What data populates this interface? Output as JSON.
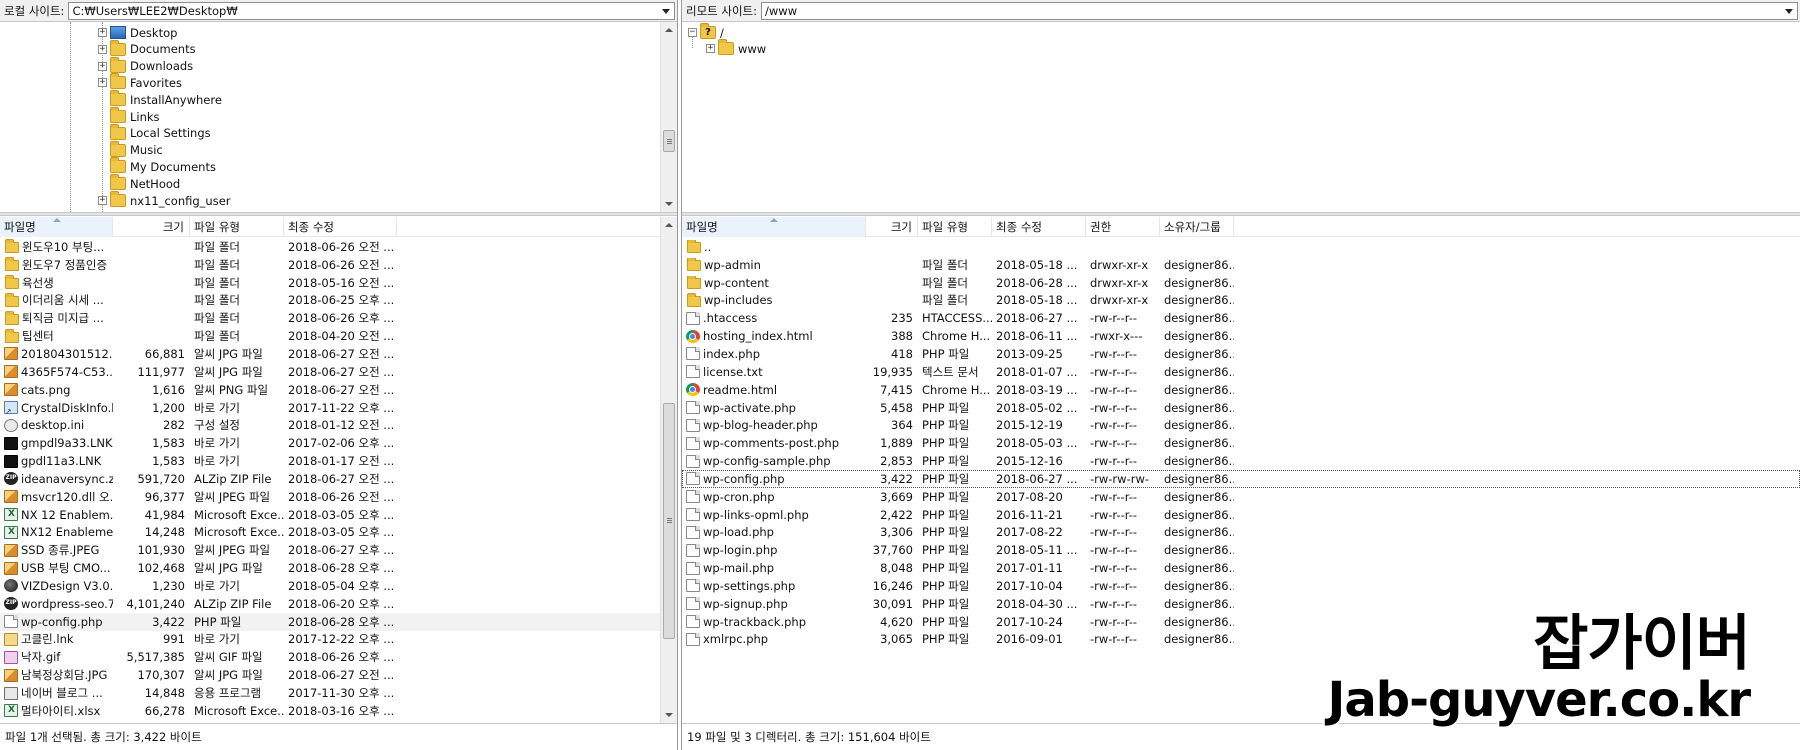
{
  "left": {
    "site_label": "로컬 사이트:",
    "site_path": "C:₩Users₩LEE2₩Desktop₩",
    "tree": [
      {
        "label": "Desktop",
        "icon": "desktop-folder-icon",
        "expander": "+"
      },
      {
        "label": "Documents",
        "icon": "folder-icon",
        "expander": "+"
      },
      {
        "label": "Downloads",
        "icon": "folder-icon",
        "expander": "+"
      },
      {
        "label": "Favorites",
        "icon": "favorites-folder-icon",
        "expander": "+"
      },
      {
        "label": "InstallAnywhere",
        "icon": "folder-icon",
        "expander": ""
      },
      {
        "label": "Links",
        "icon": "links-folder-icon",
        "expander": ""
      },
      {
        "label": "Local Settings",
        "icon": "folder-icon",
        "expander": ""
      },
      {
        "label": "Music",
        "icon": "folder-icon",
        "expander": ""
      },
      {
        "label": "My Documents",
        "icon": "folder-icon",
        "expander": ""
      },
      {
        "label": "NetHood",
        "icon": "folder-icon",
        "expander": ""
      },
      {
        "label": "nx11_config_user",
        "icon": "folder-icon",
        "expander": "+"
      }
    ],
    "columns": [
      "파일명",
      "크기",
      "파일 유형",
      "최종 수정"
    ],
    "files": [
      {
        "name": "윈도우10 부팅...",
        "size": "",
        "type": "파일 폴더",
        "modified": "2018-06-26 오전 ...",
        "icon": "folder"
      },
      {
        "name": "윈도우7 정품인증",
        "size": "",
        "type": "파일 폴더",
        "modified": "2018-06-26 오전 ...",
        "icon": "folder"
      },
      {
        "name": "육선생",
        "size": "",
        "type": "파일 폴더",
        "modified": "2018-05-16 오전 ...",
        "icon": "folder"
      },
      {
        "name": "이더리움 시세 ...",
        "size": "",
        "type": "파일 폴더",
        "modified": "2018-06-25 오후 ...",
        "icon": "folder"
      },
      {
        "name": "퇴직금 미지급 ...",
        "size": "",
        "type": "파일 폴더",
        "modified": "2018-06-26 오후 ...",
        "icon": "folder"
      },
      {
        "name": "팁센터",
        "size": "",
        "type": "파일 폴더",
        "modified": "2018-04-20 오전 ...",
        "icon": "folder"
      },
      {
        "name": "201804301512...",
        "size": "66,881",
        "type": "알씨 JPG 파일",
        "modified": "2018-06-27 오전 ...",
        "icon": "image"
      },
      {
        "name": "4365F574-C53...",
        "size": "111,977",
        "type": "알씨 JPG 파일",
        "modified": "2018-06-27 오전 ...",
        "icon": "image"
      },
      {
        "name": "cats.png",
        "size": "1,616",
        "type": "알씨 PNG 파일",
        "modified": "2018-06-27 오전 ...",
        "icon": "image"
      },
      {
        "name": "CrystalDiskInfo.l...",
        "size": "1,200",
        "type": "바로 가기",
        "modified": "2017-11-22 오후 ...",
        "icon": "shortcut"
      },
      {
        "name": "desktop.ini",
        "size": "282",
        "type": "구성 설정",
        "modified": "2018-01-12 오전 ...",
        "icon": "settings"
      },
      {
        "name": "gmpdl9a33.LNK",
        "size": "1,583",
        "type": "바로 가기",
        "modified": "2017-02-06 오후 ...",
        "icon": "blackapp"
      },
      {
        "name": "gpdl11a3.LNK",
        "size": "1,583",
        "type": "바로 가기",
        "modified": "2018-01-17 오전 ...",
        "icon": "blackapp"
      },
      {
        "name": "ideanaversync.zip",
        "size": "591,720",
        "type": "ALZip ZIP File",
        "modified": "2018-06-27 오전 ...",
        "icon": "zip"
      },
      {
        "name": "msvcr120.dll 오...",
        "size": "96,377",
        "type": "알씨 JPEG 파일",
        "modified": "2018-06-26 오전 ...",
        "icon": "image"
      },
      {
        "name": "NX 12 Enablem...",
        "size": "41,984",
        "type": "Microsoft Exce...",
        "modified": "2018-03-05 오후 ...",
        "icon": "excel"
      },
      {
        "name": "NX12 Enableme...",
        "size": "14,248",
        "type": "Microsoft Exce...",
        "modified": "2018-03-05 오후 ...",
        "icon": "excel"
      },
      {
        "name": "SSD 종류.JPEG",
        "size": "101,930",
        "type": "알씨 JPEG 파일",
        "modified": "2018-06-27 오후 ...",
        "icon": "image"
      },
      {
        "name": "USB 부팅 CMO...",
        "size": "102,468",
        "type": "알씨 JPG 파일",
        "modified": "2018-06-28 오후 ...",
        "icon": "image"
      },
      {
        "name": "VIZDesign V3.0....",
        "size": "1,230",
        "type": "바로 가기",
        "modified": "2018-05-04 오후 ...",
        "icon": "viz"
      },
      {
        "name": "wordpress-seo.7....",
        "size": "4,101,240",
        "type": "ALZip ZIP File",
        "modified": "2018-06-20 오후 ...",
        "icon": "zip"
      },
      {
        "name": "wp-config.php",
        "size": "3,422",
        "type": "PHP 파일",
        "modified": "2018-06-28 오후 ...",
        "icon": "doc",
        "selected": true
      },
      {
        "name": "고클린.lnk",
        "size": "991",
        "type": "바로 가기",
        "modified": "2017-12-22 오후 ...",
        "icon": "hangul"
      },
      {
        "name": "낙자.gif",
        "size": "5,517,385",
        "type": "알씨 GIF 파일",
        "modified": "2018-06-26 오후 ...",
        "icon": "gif"
      },
      {
        "name": "남북정상회담.JPG",
        "size": "170,307",
        "type": "알씨 JPG 파일",
        "modified": "2018-06-27 오전 ...",
        "icon": "image"
      },
      {
        "name": "네이버 블로그 ...",
        "size": "14,848",
        "type": "응용 프로그램",
        "modified": "2017-11-30 오후 ...",
        "icon": "app"
      },
      {
        "name": "멀타아이티.xlsx",
        "size": "66,278",
        "type": "Microsoft Exce...",
        "modified": "2018-03-16 오후 ...",
        "icon": "excel"
      }
    ],
    "status": "파일 1개 선택됨. 총 크기: 3,422 바이트"
  },
  "right": {
    "site_label": "리모트 사이트:",
    "site_path": "/www",
    "tree": [
      {
        "label": "/",
        "icon": "unknown-folder-icon",
        "expander": "−"
      },
      {
        "label": "www",
        "icon": "folder-icon",
        "expander": "+"
      }
    ],
    "columns": [
      "파일명",
      "크기",
      "파일 유형",
      "최종 수정",
      "권한",
      "소유자/그룹"
    ],
    "files": [
      {
        "name": "..",
        "size": "",
        "type": "",
        "modified": "",
        "perm": "",
        "owner": "",
        "icon": "folder"
      },
      {
        "name": "wp-admin",
        "size": "",
        "type": "파일 폴더",
        "modified": "2018-05-18 ...",
        "perm": "drwxr-xr-x",
        "owner": "designer86...",
        "icon": "folder"
      },
      {
        "name": "wp-content",
        "size": "",
        "type": "파일 폴더",
        "modified": "2018-06-28 ...",
        "perm": "drwxr-xr-x",
        "owner": "designer86...",
        "icon": "folder"
      },
      {
        "name": "wp-includes",
        "size": "",
        "type": "파일 폴더",
        "modified": "2018-05-18 ...",
        "perm": "drwxr-xr-x",
        "owner": "designer86...",
        "icon": "folder"
      },
      {
        "name": ".htaccess",
        "size": "235",
        "type": "HTACCESS...",
        "modified": "2018-06-27 ...",
        "perm": "-rw-r--r--",
        "owner": "designer86...",
        "icon": "doc"
      },
      {
        "name": "hosting_index.html",
        "size": "388",
        "type": "Chrome H...",
        "modified": "2018-06-11 ...",
        "perm": "-rwxr-x---",
        "owner": "designer86...",
        "icon": "chrome"
      },
      {
        "name": "index.php",
        "size": "418",
        "type": "PHP 파일",
        "modified": "2013-09-25",
        "perm": "-rw-r--r--",
        "owner": "designer86...",
        "icon": "doc"
      },
      {
        "name": "license.txt",
        "size": "19,935",
        "type": "텍스트 문서",
        "modified": "2018-01-07 ...",
        "perm": "-rw-r--r--",
        "owner": "designer86...",
        "icon": "doc"
      },
      {
        "name": "readme.html",
        "size": "7,415",
        "type": "Chrome H...",
        "modified": "2018-03-19 ...",
        "perm": "-rw-r--r--",
        "owner": "designer86...",
        "icon": "chrome"
      },
      {
        "name": "wp-activate.php",
        "size": "5,458",
        "type": "PHP 파일",
        "modified": "2018-05-02 ...",
        "perm": "-rw-r--r--",
        "owner": "designer86...",
        "icon": "doc"
      },
      {
        "name": "wp-blog-header.php",
        "size": "364",
        "type": "PHP 파일",
        "modified": "2015-12-19",
        "perm": "-rw-r--r--",
        "owner": "designer86...",
        "icon": "doc"
      },
      {
        "name": "wp-comments-post.php",
        "size": "1,889",
        "type": "PHP 파일",
        "modified": "2018-05-03 ...",
        "perm": "-rw-r--r--",
        "owner": "designer86...",
        "icon": "doc"
      },
      {
        "name": "wp-config-sample.php",
        "size": "2,853",
        "type": "PHP 파일",
        "modified": "2015-12-16",
        "perm": "-rw-r--r--",
        "owner": "designer86...",
        "icon": "doc"
      },
      {
        "name": "wp-config.php",
        "size": "3,422",
        "type": "PHP 파일",
        "modified": "2018-06-27 ...",
        "perm": "-rw-rw-rw-",
        "owner": "designer86...",
        "icon": "doc",
        "focused": true
      },
      {
        "name": "wp-cron.php",
        "size": "3,669",
        "type": "PHP 파일",
        "modified": "2017-08-20",
        "perm": "-rw-r--r--",
        "owner": "designer86...",
        "icon": "doc"
      },
      {
        "name": "wp-links-opml.php",
        "size": "2,422",
        "type": "PHP 파일",
        "modified": "2016-11-21",
        "perm": "-rw-r--r--",
        "owner": "designer86...",
        "icon": "doc"
      },
      {
        "name": "wp-load.php",
        "size": "3,306",
        "type": "PHP 파일",
        "modified": "2017-08-22",
        "perm": "-rw-r--r--",
        "owner": "designer86...",
        "icon": "doc"
      },
      {
        "name": "wp-login.php",
        "size": "37,760",
        "type": "PHP 파일",
        "modified": "2018-05-11 ...",
        "perm": "-rw-r--r--",
        "owner": "designer86...",
        "icon": "doc"
      },
      {
        "name": "wp-mail.php",
        "size": "8,048",
        "type": "PHP 파일",
        "modified": "2017-01-11",
        "perm": "-rw-r--r--",
        "owner": "designer86...",
        "icon": "doc"
      },
      {
        "name": "wp-settings.php",
        "size": "16,246",
        "type": "PHP 파일",
        "modified": "2017-10-04",
        "perm": "-rw-r--r--",
        "owner": "designer86...",
        "icon": "doc"
      },
      {
        "name": "wp-signup.php",
        "size": "30,091",
        "type": "PHP 파일",
        "modified": "2018-04-30 ...",
        "perm": "-rw-r--r--",
        "owner": "designer86...",
        "icon": "doc"
      },
      {
        "name": "wp-trackback.php",
        "size": "4,620",
        "type": "PHP 파일",
        "modified": "2017-10-24",
        "perm": "-rw-r--r--",
        "owner": "designer86...",
        "icon": "doc"
      },
      {
        "name": "xmlrpc.php",
        "size": "3,065",
        "type": "PHP 파일",
        "modified": "2016-09-01",
        "perm": "-rw-r--r--",
        "owner": "designer86...",
        "icon": "doc"
      }
    ],
    "status": "19 파일 및 3 디렉터리. 총 크기: 151,604 바이트"
  },
  "watermark": {
    "korean": "잡가이버",
    "url": "Jab-guyver.co.kr"
  }
}
